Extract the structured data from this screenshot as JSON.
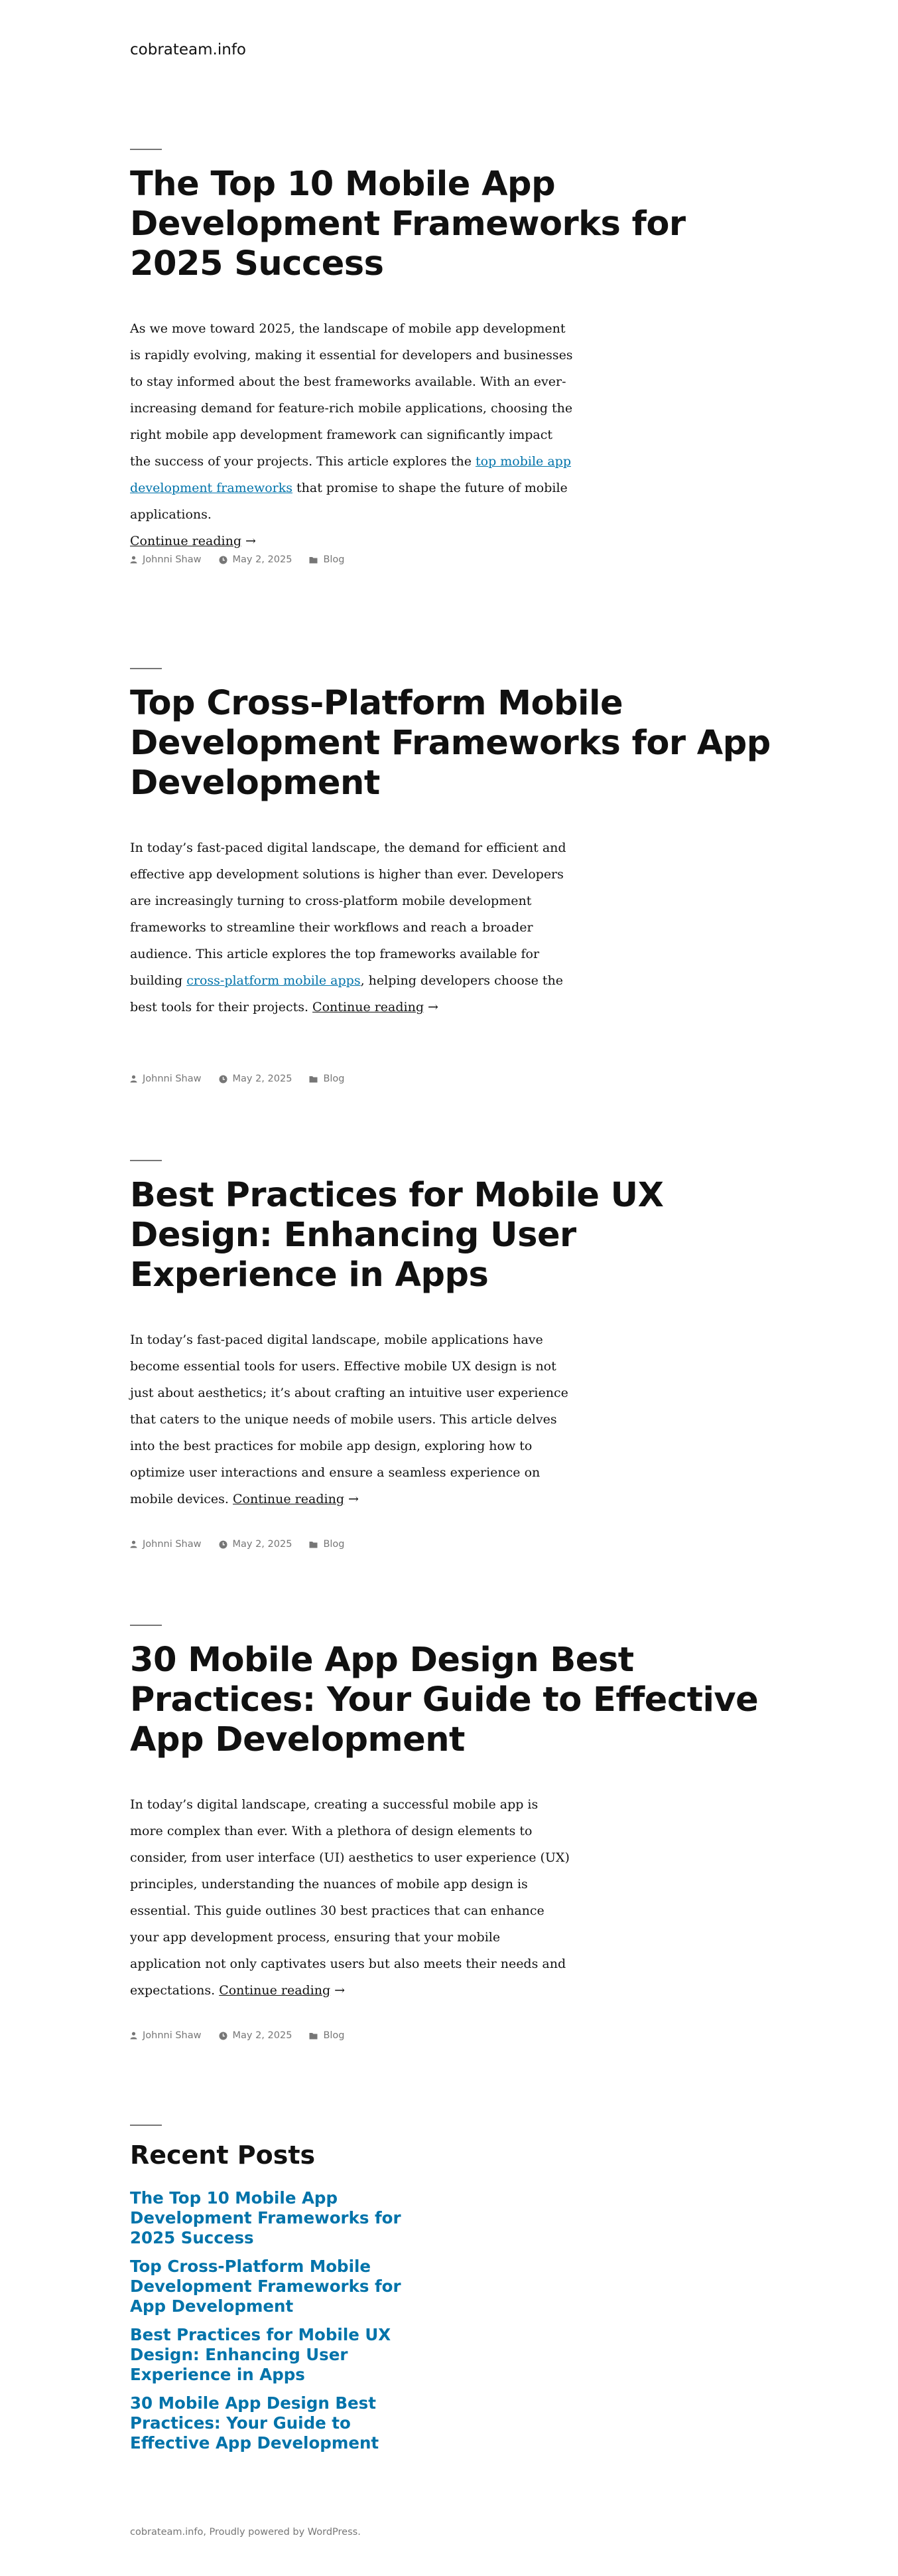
{
  "site": {
    "title": "cobrateam.info"
  },
  "posts": [
    {
      "title": "The Top 10 Mobile App Development Frameworks for 2025 Success",
      "excerpt_before": "As we move toward 2025, the landscape of mobile app development is rapidly evolving, making it essential for developers and businesses to stay informed about the best frameworks available. With an ever-increasing demand for feature-rich mobile applications, choosing the right mobile app development framework can significantly impact the success of your projects. This article explores the ",
      "inline_link": "top mobile app development frameworks",
      "excerpt_after": " that promise to shape the future of mobile applications.",
      "continue": "Continue reading",
      "author": "Johnni Shaw",
      "date": "May 2, 2025",
      "category": "Blog"
    },
    {
      "title": "Top Cross-Platform Mobile Development Frameworks for App Development",
      "excerpt_before": "In today’s fast-paced digital landscape, the demand for efficient and effective app development solutions is higher than ever. Developers are increasingly turning to cross-platform mobile development frameworks to streamline their workflows and reach a broader audience. This article explores the top frameworks available for building ",
      "inline_link": "cross-platform mobile apps",
      "excerpt_after": ", helping developers choose the best tools for their projects. ",
      "continue": "Continue reading",
      "author": "Johnni Shaw",
      "date": "May 2, 2025",
      "category": "Blog"
    },
    {
      "title": "Best Practices for Mobile UX Design: Enhancing User Experience in Apps",
      "excerpt_before": "In today’s fast-paced digital landscape, mobile applications have become essential tools for users. Effective mobile UX design is not just about aesthetics; it’s about crafting an intuitive user experience that caters to the unique needs of mobile users. This article delves into the best practices for mobile app design, exploring how to optimize user interactions and ensure a seamless experience on mobile devices. ",
      "continue": "Continue reading",
      "author": "Johnni Shaw",
      "date": "May 2, 2025",
      "category": "Blog"
    },
    {
      "title": "30 Mobile App Design Best Practices: Your Guide to Effective App Development",
      "excerpt_before": "In today’s digital landscape, creating a successful mobile app is more complex than ever. With a plethora of design elements to consider, from user interface (UI) aesthetics to user experience (UX) principles, understanding the nuances of mobile app design is essential. This guide outlines 30 best practices that can enhance your app development process, ensuring that your mobile application not only captivates users but also meets their needs and expectations. ",
      "continue": "Continue reading",
      "author": "Johnni Shaw",
      "date": "May 2, 2025",
      "category": "Blog"
    }
  ],
  "arrow": "→",
  "recent_posts": {
    "heading": "Recent Posts",
    "items": [
      "The Top 10 Mobile App Development Frameworks for 2025 Success",
      "Top Cross-Platform Mobile Development Frameworks for App Development",
      "Best Practices for Mobile UX Design: Enhancing User Experience in Apps",
      "30 Mobile App Design Best Practices: Your Guide to Effective App Development"
    ]
  },
  "footer": {
    "text": "cobrateam.info, Proudly powered by WordPress."
  },
  "colors": {
    "link": "#0073aa",
    "meta": "#767676",
    "text": "#111111"
  },
  "icons": {
    "author": "person-icon",
    "date": "clock-icon",
    "category": "folder-icon"
  }
}
